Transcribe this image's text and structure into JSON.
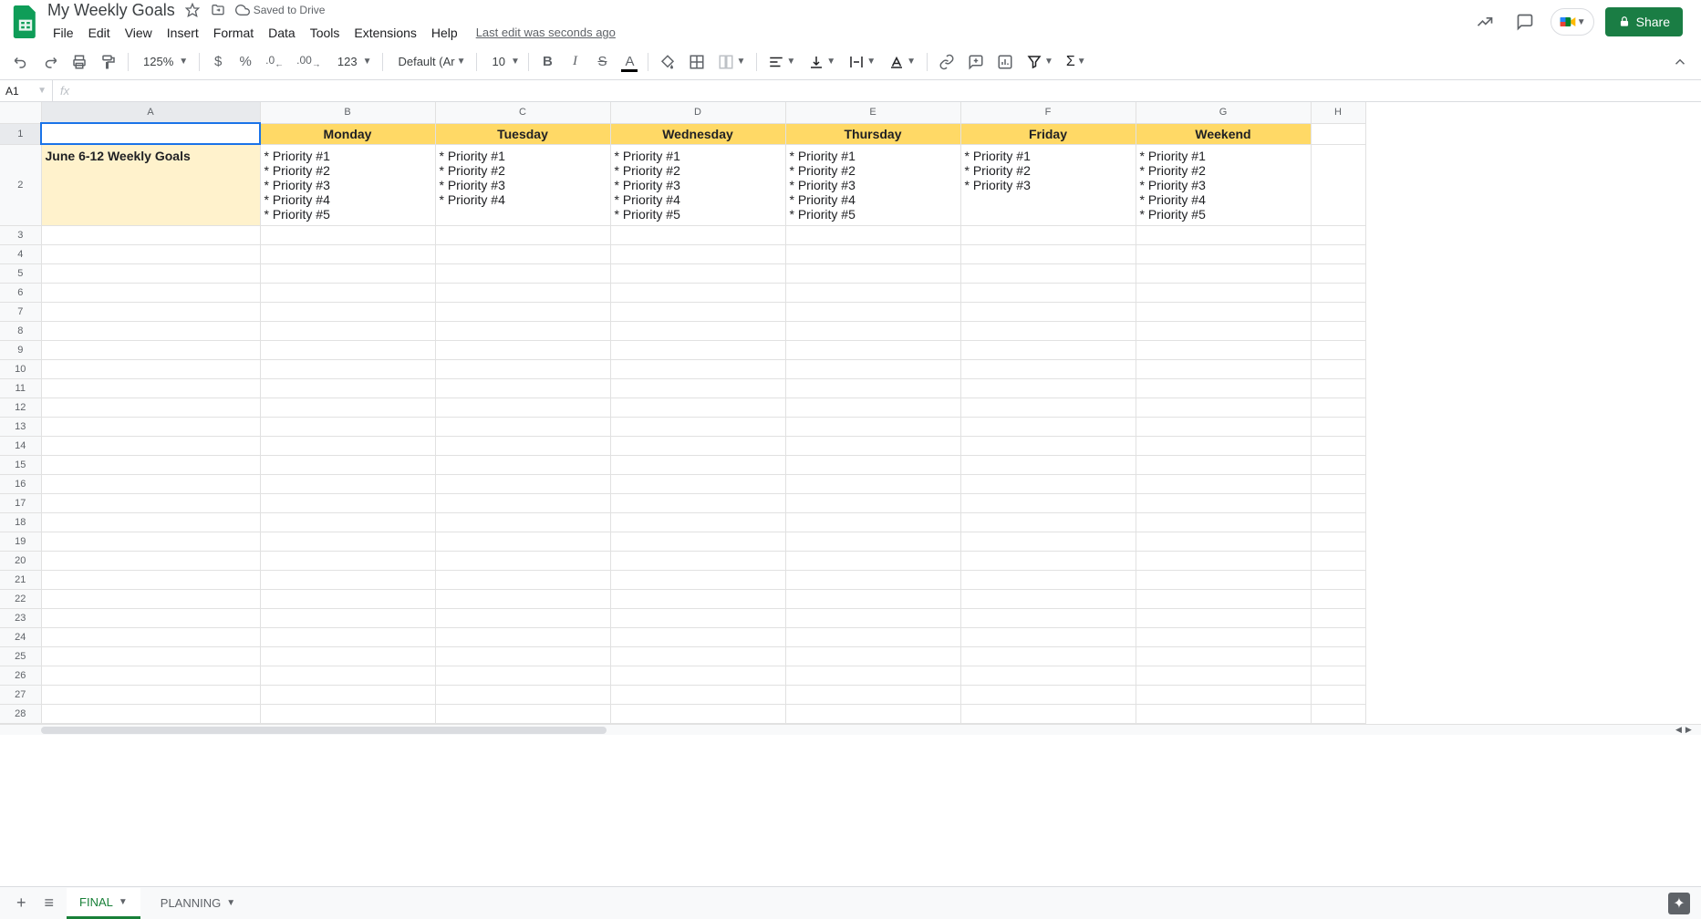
{
  "titlebar": {
    "doc_title": "My Weekly Goals",
    "saved_status": "Saved to Drive",
    "last_edit": "Last edit was seconds ago",
    "share_label": "Share"
  },
  "menu": {
    "file": "File",
    "edit": "Edit",
    "view": "View",
    "insert": "Insert",
    "format": "Format",
    "data": "Data",
    "tools": "Tools",
    "extensions": "Extensions",
    "help": "Help"
  },
  "toolbar": {
    "zoom": "125%",
    "font": "Default (Ari...",
    "font_size": "10",
    "more_formats": "123"
  },
  "formula": {
    "name_box": "A1",
    "fx": "fx",
    "value": ""
  },
  "columns": [
    "A",
    "B",
    "C",
    "D",
    "E",
    "F",
    "G",
    "H"
  ],
  "grid": {
    "header_row": {
      "A": "",
      "B": "Monday",
      "C": "Tuesday",
      "D": "Wednesday",
      "E": "Thursday",
      "F": "Friday",
      "G": "Weekend"
    },
    "data_row": {
      "A": "June 6-12 Weekly Goals",
      "B": "* Priority #1\n* Priority #2\n* Priority #3\n* Priority #4\n* Priority #5",
      "C": "* Priority #1\n* Priority #2\n* Priority #3\n* Priority #4",
      "D": "* Priority #1\n* Priority #2\n* Priority #3\n* Priority #4\n* Priority #5",
      "E": "* Priority #1\n* Priority #2\n* Priority #3\n* Priority #4\n* Priority #5",
      "F": "* Priority #1\n* Priority #2\n* Priority #3",
      "G": "* Priority #1\n* Priority #2\n* Priority #3\n* Priority #4\n* Priority #5"
    }
  },
  "tabs": {
    "tab1": "FINAL",
    "tab2": "PLANNING"
  }
}
